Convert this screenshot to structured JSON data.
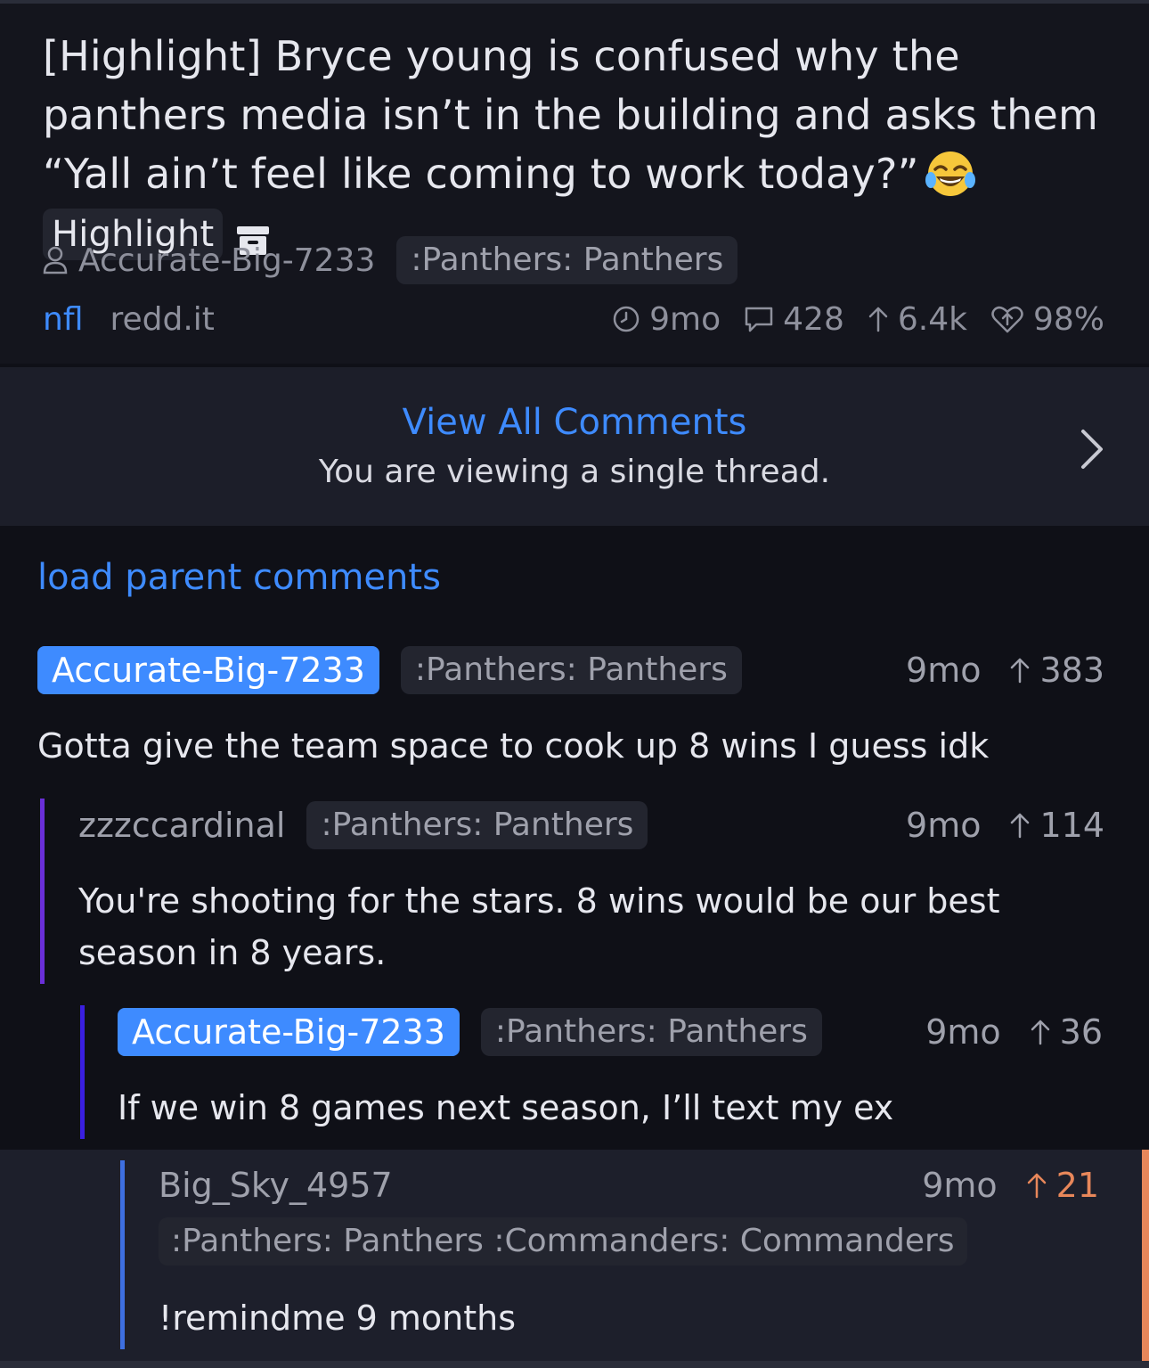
{
  "post": {
    "title": "[Highlight] Bryce young is confused why the panthers media isn’t in the building and asks them “Yall ain’t feel like coming to work today?”",
    "flair": "Highlight",
    "author": "Accurate-Big-7233",
    "author_flair": ":Panthers: Panthers",
    "subreddit": "nfl",
    "domain": "redd.it",
    "age": "9mo",
    "comments": "428",
    "score": "6.4k",
    "upvote_ratio": "98%"
  },
  "thread_banner": {
    "link": "View All Comments",
    "subtitle": "You are viewing a single thread."
  },
  "load_parent": "load parent comments",
  "comments": [
    {
      "author": "Accurate-Big-7233",
      "flair": ":Panthers: Panthers",
      "age": "9mo",
      "score": "383",
      "body": "Gotta give the team space to cook up 8 wins I guess idk"
    },
    {
      "author": "zzzccardinal",
      "flair": ":Panthers: Panthers",
      "age": "9mo",
      "score": "114",
      "body_line1": "You're shooting for the stars. 8 wins would be our best",
      "body_line2": "season in 8 years."
    },
    {
      "author": "Accurate-Big-7233",
      "flair": ":Panthers: Panthers",
      "age": "9mo",
      "score": "36",
      "body": "If we win 8 games next season, I’ll text my ex"
    },
    {
      "author": "Big_Sky_4957",
      "flair": ":Panthers: Panthers :Commanders: Commanders",
      "age": "9mo",
      "score": "21",
      "body": "!remindme 9 months"
    }
  ],
  "colors": {
    "accent": "#3e8bff",
    "upvoted": "#e8875a",
    "depth1": "#6a2fd8",
    "depth2": "#3a1fe0",
    "depth3": "#3e6fe0"
  },
  "icons": [
    "emoji-joy-icon",
    "archive-icon",
    "person-icon",
    "clock-icon",
    "comment-icon",
    "upvote-arrow-icon",
    "heart-icon",
    "chevron-right-icon"
  ]
}
